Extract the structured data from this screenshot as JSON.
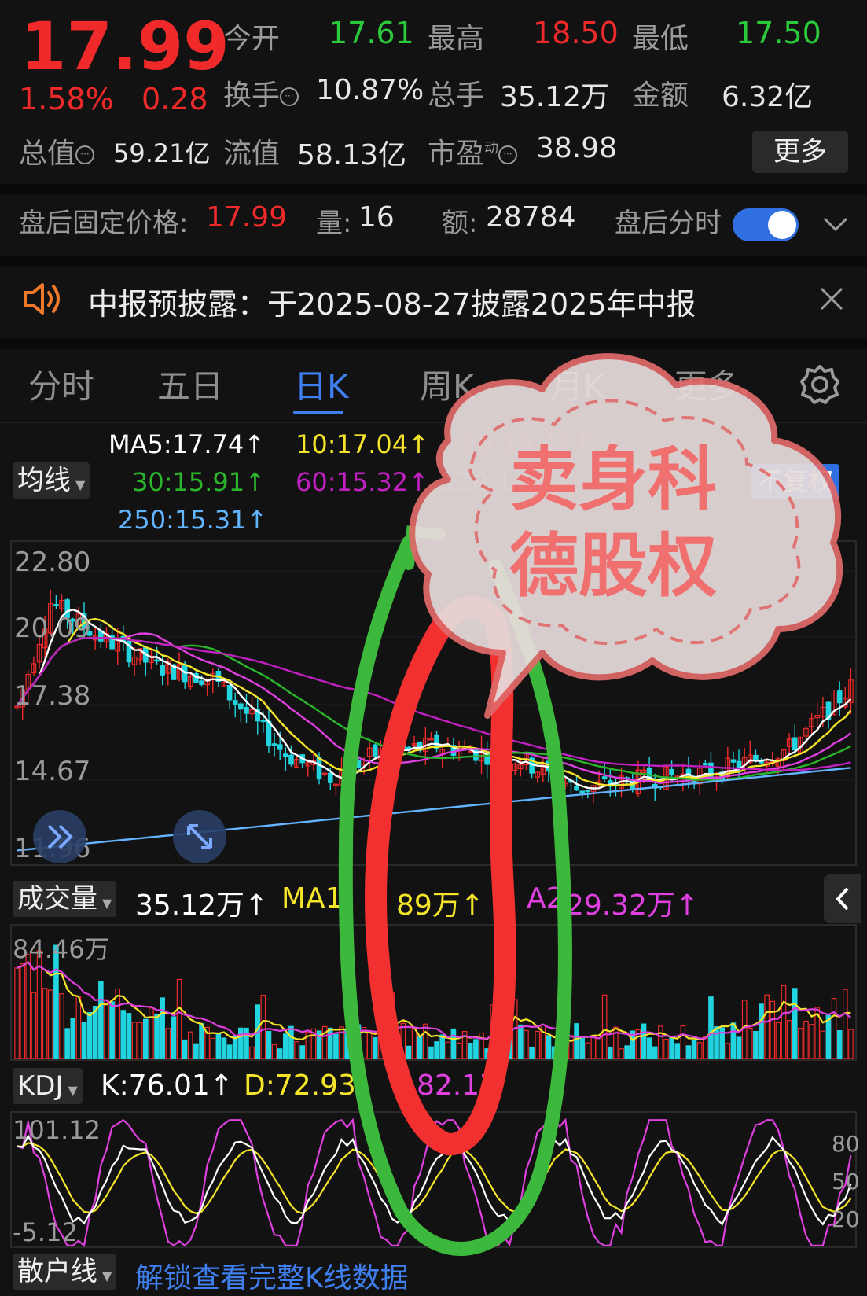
{
  "quote": {
    "price": "17.99",
    "change_pct": "1.58%",
    "change_abs": "0.28",
    "open_label": "今开",
    "open_value": "17.61",
    "high_label": "最高",
    "high_value": "18.50",
    "low_label": "最低",
    "low_value": "17.50",
    "turnover_label": "换手",
    "turnover_value": "10.87%",
    "volume_label": "总手",
    "volume_value": "35.12万",
    "amount_label": "金额",
    "amount_value": "6.32亿",
    "mcap_label": "总值",
    "mcap_value": "59.21亿",
    "float_label": "流值",
    "float_value": "58.13亿",
    "pe_label": "市盈",
    "pe_sup": "动",
    "pe_value": "38.98",
    "more_button": "更多"
  },
  "after_hours": {
    "price_label": "盘后固定价格:",
    "price_value": "17.99",
    "qty_label": "量:",
    "qty_value": "16",
    "amount_label": "额:",
    "amount_value": "28784",
    "toggle_label": "盘后分时",
    "toggle_on": true
  },
  "notice": {
    "text": "中报预披露：于2025-08-27披露2025年中报"
  },
  "tabs": [
    {
      "label": "分时"
    },
    {
      "label": "五日"
    },
    {
      "label": "日K"
    },
    {
      "label": "周K"
    },
    {
      "label": "月K"
    },
    {
      "label": "更多"
    }
  ],
  "ma_bar": {
    "selector": "均线",
    "ma5": "MA5:17.74↑",
    "ma10": "10:17.04↑",
    "ma20": "20:16.42↑",
    "ma30": "30:15.91↑",
    "ma60": "60:15.32↑",
    "ma120": "120:1",
    "ma250": "250:15.31↑",
    "adjust": "不复权"
  },
  "price_axis": [
    "22.80",
    "20.09",
    "17.38",
    "14.67",
    "11.96"
  ],
  "volume_bar": {
    "selector": "成交量",
    "vol": "35.12万↑",
    "ma1": "MA1",
    "ma1_rest": "89万↑",
    "ma2": "A2",
    "ma2_rest": "29.32万↑",
    "axis_max": "84.46万"
  },
  "kdj_bar": {
    "selector": "KDJ",
    "k": "K:76.01↑",
    "d": "D:72.93",
    "j": "82.17",
    "axis_max": "101.12",
    "axis_min": "-5.12",
    "level_80": "80",
    "level_50": "50",
    "level_20": "20"
  },
  "bottom_bar": {
    "selector": "散户线",
    "unlock_link": "解锁查看完整K线数据"
  },
  "annotation": {
    "bubble_line1": "卖身科",
    "bubble_line2": "德股权"
  },
  "colors": {
    "up": "#f02a2a",
    "down": "#21d4e0",
    "ma5": "#ffffff",
    "ma10": "#f5e52a",
    "ma20": "#e040e0",
    "ma30": "#2bb52b",
    "ma60": "#c020c0",
    "ma250": "#62b4ff",
    "accent": "#3f7ff0"
  }
}
